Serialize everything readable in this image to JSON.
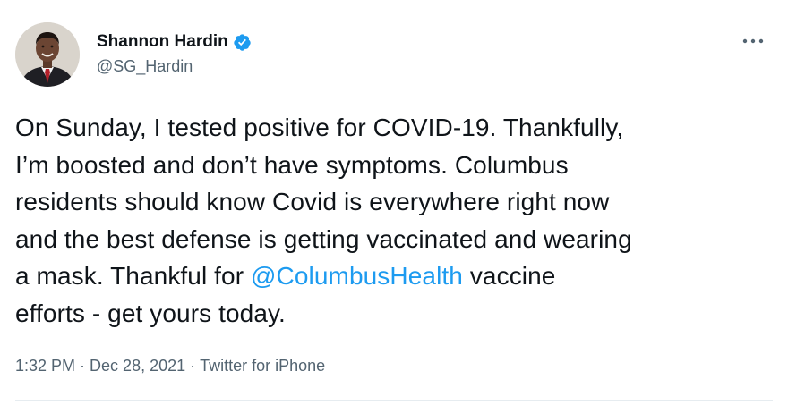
{
  "author": {
    "display_name": "Shannon Hardin",
    "handle": "@SG_Hardin",
    "verified": true
  },
  "tweet": {
    "lines": [
      [
        {
          "text": "On Sunday, I tested positive for COVID-19. Thankfully,",
          "type": "text"
        }
      ],
      [
        {
          "text": "I’m boosted and don’t have symptoms. Columbus",
          "type": "text"
        }
      ],
      [
        {
          "text": "residents should know Covid is everywhere right now",
          "type": "text"
        }
      ],
      [
        {
          "text": "and the best defense is getting vaccinated and wearing",
          "type": "text"
        }
      ],
      [
        {
          "text": "a mask. Thankful for ",
          "type": "text"
        },
        {
          "text": "@ColumbusHealth",
          "type": "mention"
        },
        {
          "text": " vaccine",
          "type": "text"
        }
      ],
      [
        {
          "text": "efforts - get yours today.",
          "type": "text"
        }
      ]
    ]
  },
  "meta": {
    "time": "1:32 PM",
    "separator": "·",
    "date": "Dec 28, 2021",
    "source": "Twitter for iPhone"
  },
  "colors": {
    "link": "#1d9bf0",
    "secondary_text": "#536471",
    "verified_badge": "#1d9bf0"
  },
  "icons": {
    "verified": "verified-badge-icon",
    "more": "more-options-icon"
  }
}
